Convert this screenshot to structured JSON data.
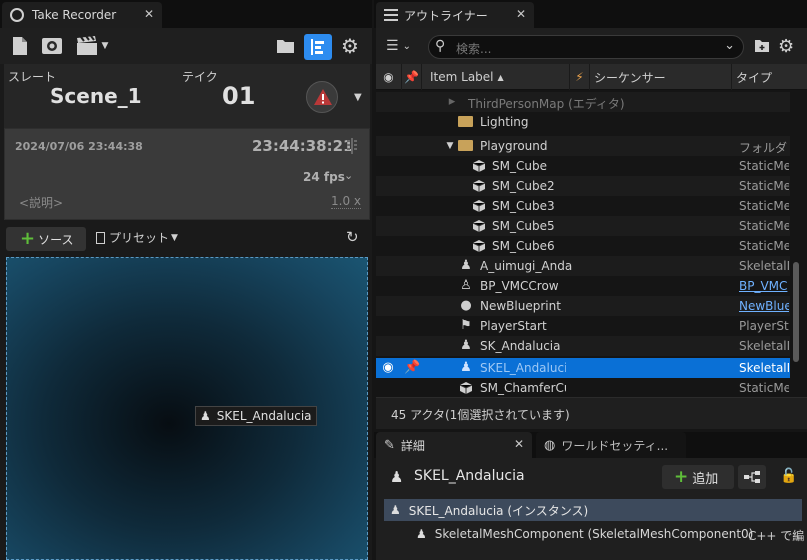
{
  "take_recorder": {
    "tab_title": "Take Recorder",
    "slate_label": "スレート",
    "slate_value": "Scene_1",
    "take_label": "テイク",
    "take_value": "01",
    "date": "2024/07/06 23:44:38",
    "timecode": "23:44:38:21",
    "fps": "24 fps",
    "description_placeholder": "<説明>",
    "speed": "1.0 x",
    "source_button": "ソース",
    "preset_button": "プリセット",
    "viewport_label": "SKEL_Andalucia"
  },
  "outliner": {
    "tab_title": "アウトライナー",
    "search_placeholder": "検索...",
    "filter_count": "",
    "col_item_label": "Item Label",
    "col_sequencer": "シーケンサー",
    "col_type": "タイプ",
    "rows": [
      {
        "label": "ThirdPersonMap (エディタ)",
        "type": ""
      },
      {
        "label": "Lighting",
        "type": ""
      },
      {
        "label": "Playground",
        "type": "フォルダ"
      },
      {
        "label": "SM_Cube",
        "type": "StaticMe"
      },
      {
        "label": "SM_Cube2",
        "type": "StaticMe"
      },
      {
        "label": "SM_Cube3",
        "type": "StaticMe"
      },
      {
        "label": "SM_Cube5",
        "type": "StaticMe"
      },
      {
        "label": "SM_Cube6",
        "type": "StaticMe"
      },
      {
        "label": "A_uimugi_Anda",
        "type": "SkeletalM"
      },
      {
        "label": "BP_VMCCrow",
        "type": "BP_VMC"
      },
      {
        "label": "NewBlueprint",
        "type": "NewBlue"
      },
      {
        "label": "PlayerStart",
        "type": "PlayerSt"
      },
      {
        "label": "SK_Andalucia",
        "type": "SkeletalM"
      },
      {
        "label": "SKEL_Andaluci",
        "type": "SkeletalM"
      },
      {
        "label": "SM_ChamferCu",
        "type": "StaticMe"
      }
    ],
    "status": "45 アクタ(1個選択されています)"
  },
  "details": {
    "tab_title": "詳細",
    "world_tab_title": "ワールドセッティ...",
    "actor_name": "SKEL_Andalucia",
    "add_button": "追加",
    "instance_row": "SKEL_Andalucia (インスタンス)",
    "component_row": "SkeletalMeshComponent (SkeletalMeshComponent0)",
    "component_hint": "C++ で編"
  },
  "colors": {
    "selection": "#0a70d6",
    "accent_blue": "#2d8cf0",
    "record_red": "#b93838",
    "add_green": "#5fbe3a"
  }
}
